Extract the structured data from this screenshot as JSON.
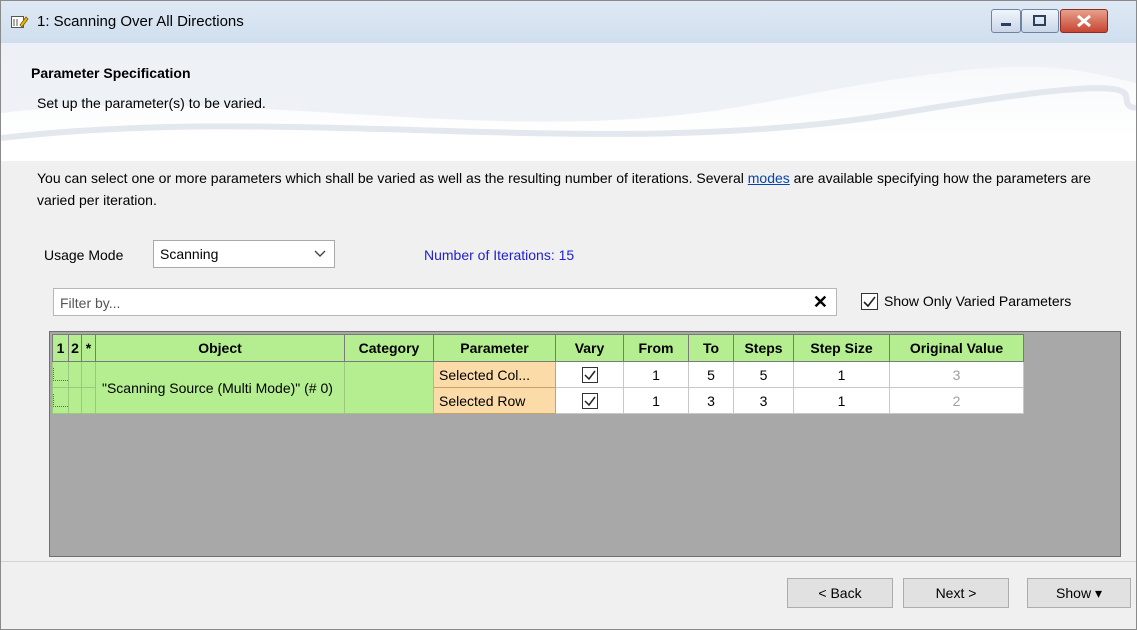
{
  "window": {
    "title": "1: Scanning Over All Directions",
    "controls": [
      "minimize-icon",
      "maximize-icon",
      "close-icon"
    ]
  },
  "header": {
    "title": "Parameter Specification",
    "subtitle": "Set up the parameter(s) to be varied."
  },
  "description": {
    "before_link": "You can select one or more parameters which shall be varied as well as the resulting number of iterations. Several ",
    "link": "modes",
    "after_link": " are available specifying how the parameters are varied per iteration."
  },
  "usage": {
    "label": "Usage Mode",
    "value": "Scanning"
  },
  "iterations_text": "Number of Iterations: 15",
  "filter": {
    "placeholder": "Filter by...",
    "clear": "✕"
  },
  "show_only_varied": {
    "label": "Show Only Varied Parameters",
    "checked": true
  },
  "grid": {
    "headers": [
      "1",
      "2",
      "*",
      "Object",
      "Category",
      "Parameter",
      "Vary",
      "From",
      "To",
      "Steps",
      "Step Size",
      "Original Value"
    ],
    "object": "\"Scanning Source (Multi Mode)\" (# 0)",
    "category": "",
    "rows": [
      {
        "parameter": "Selected Col...",
        "vary": true,
        "from": "1",
        "to": "5",
        "steps": "5",
        "step_size": "1",
        "original": "3"
      },
      {
        "parameter": "Selected Row",
        "vary": true,
        "from": "1",
        "to": "3",
        "steps": "3",
        "step_size": "1",
        "original": "2"
      }
    ]
  },
  "footer": {
    "back": "< Back",
    "next": "Next >",
    "show": "Show ▾"
  },
  "colors": {
    "header_green": "#b4ee90",
    "parameter_orange": "#fbdca8",
    "iterations_blue": "#1f1fcf",
    "grid_background": "#a8a8a8"
  }
}
